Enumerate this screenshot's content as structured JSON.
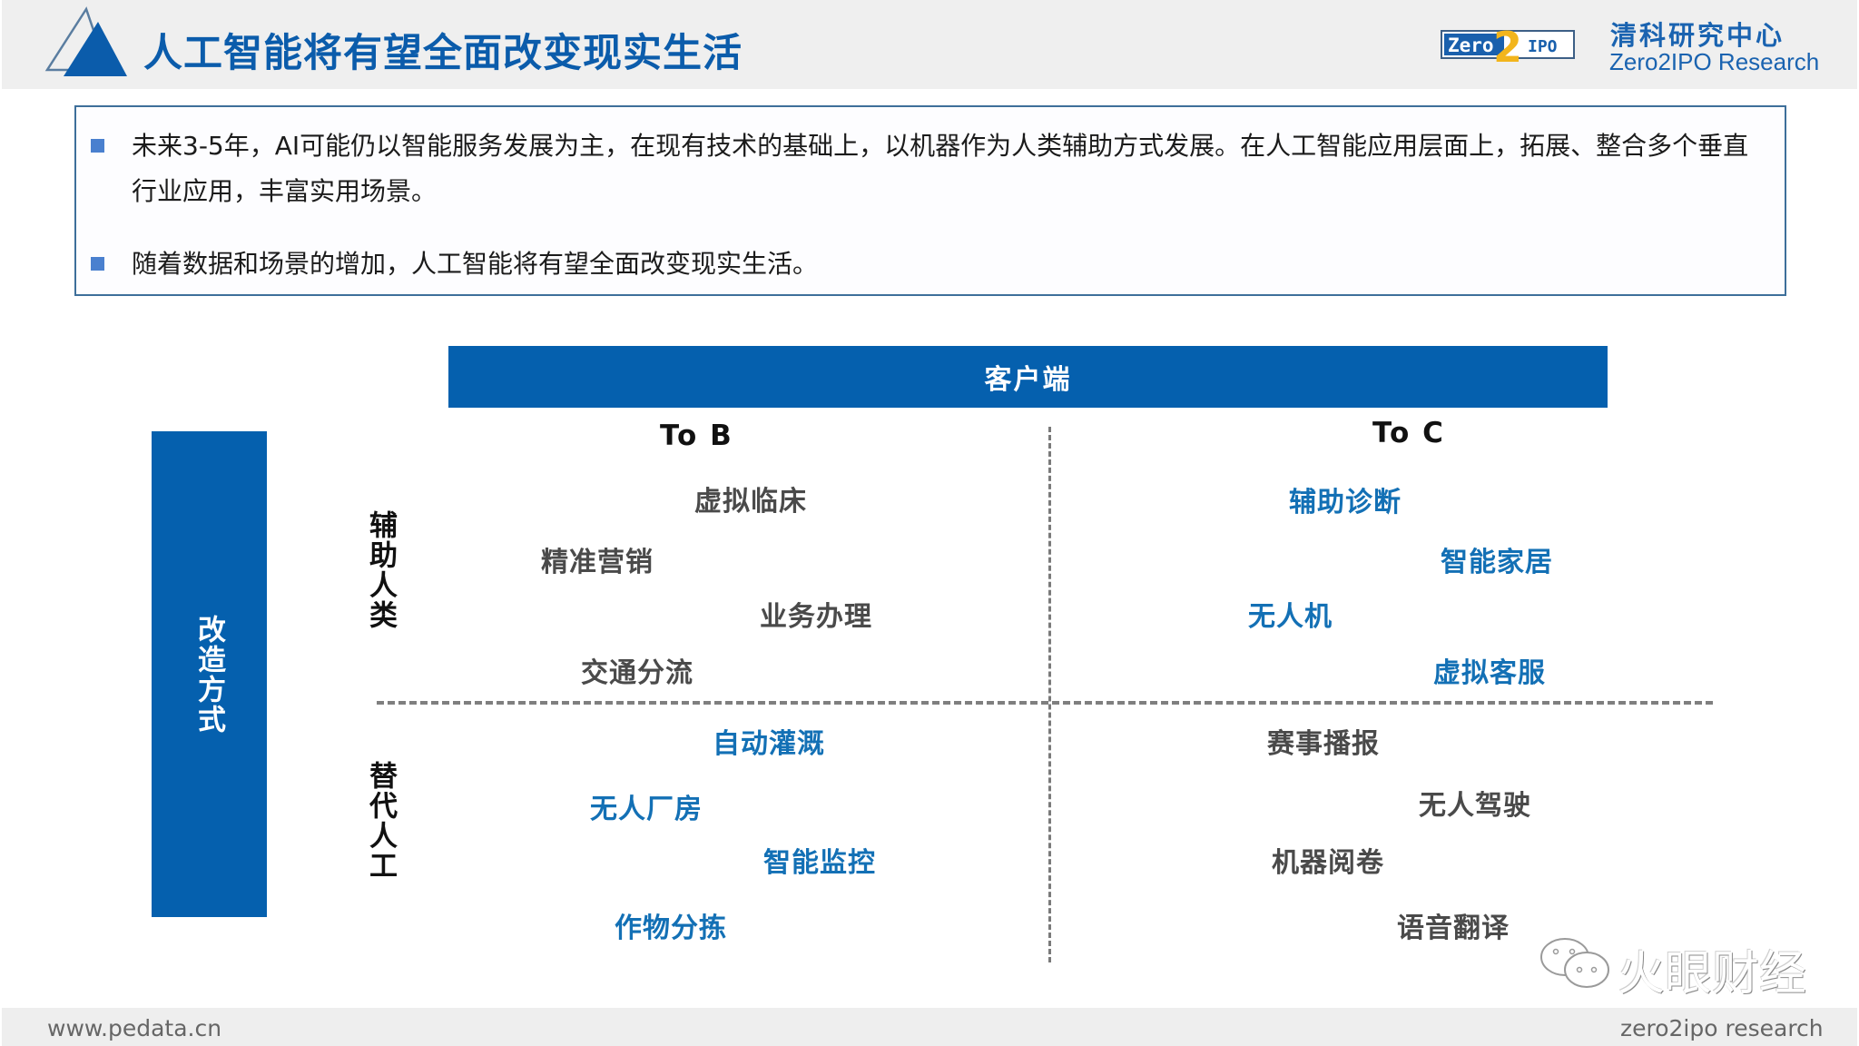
{
  "header": {
    "title": "人工智能将有望全面改变现实生活",
    "brand_logo": {
      "left_text": "Zero",
      "middle_text": "2",
      "right_text": "IPO"
    },
    "brand_cn": "清科研究中心",
    "brand_en": "Zero2IPO Research"
  },
  "summary": {
    "bullets": [
      {
        "lines": [
          "未来3-5年，AI可能仍以智能服务发展为主，在现有技术的基础上，以机器作为人类辅助方式发展。在人工智能应用层面上，拓展、整合多个垂直",
          "行业应用，丰富实用场景。"
        ]
      },
      {
        "lines": [
          "随着数据和场景的增加，人工智能将有望全面改变现实生活。"
        ]
      }
    ]
  },
  "diagram": {
    "x_axis_title": "客户端",
    "y_axis_title": "改造方式",
    "columns": [
      "To B",
      "To C"
    ],
    "rows": [
      "辅助人类",
      "替代人工"
    ],
    "quadrants": {
      "assist_tob": [
        {
          "label": "虚拟临床",
          "color": "gray"
        },
        {
          "label": "精准营销",
          "color": "gray"
        },
        {
          "label": "业务办理",
          "color": "gray"
        },
        {
          "label": "交通分流",
          "color": "gray"
        }
      ],
      "assist_toc": [
        {
          "label": "辅助诊断",
          "color": "blue"
        },
        {
          "label": "智能家居",
          "color": "blue"
        },
        {
          "label": "无人机",
          "color": "blue"
        },
        {
          "label": "虚拟客服",
          "color": "blue"
        }
      ],
      "replace_tob": [
        {
          "label": "自动灌溉",
          "color": "blue"
        },
        {
          "label": "无人厂房",
          "color": "blue"
        },
        {
          "label": "智能监控",
          "color": "blue"
        },
        {
          "label": "作物分拣",
          "color": "blue"
        }
      ],
      "replace_toc": [
        {
          "label": "赛事播报",
          "color": "gray"
        },
        {
          "label": "无人驾驶",
          "color": "gray"
        },
        {
          "label": "机器阅卷",
          "color": "gray"
        },
        {
          "label": "语音翻译",
          "color": "gray"
        }
      ]
    }
  },
  "watermark": {
    "text": "火眼财经"
  },
  "footer": {
    "left": "www.pedata.cn",
    "right": "zero2ipo research"
  },
  "colors": {
    "primary_blue": "#0560ae",
    "title_blue": "#0b5cab",
    "item_blue": "#1370b5",
    "item_gray": "#4a4a4a",
    "logo_gold": "#f2b51c"
  }
}
